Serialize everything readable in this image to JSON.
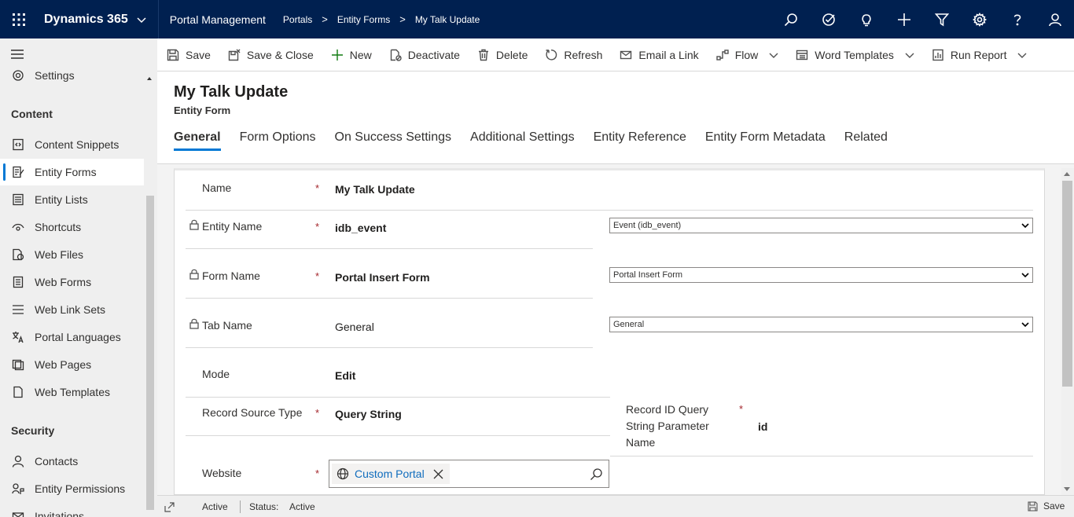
{
  "topbar": {
    "app_name": "Dynamics 365",
    "area_name": "Portal Management",
    "breadcrumbs": [
      "Portals",
      "Entity Forms",
      "My Talk Update"
    ],
    "icons": [
      "search-icon",
      "task-icon",
      "lightbulb-icon",
      "plus-icon",
      "filter-icon",
      "gear-icon",
      "help-icon",
      "user-icon"
    ]
  },
  "sidebar": {
    "top_item": "Settings",
    "sections": [
      {
        "title": "Content",
        "items": [
          "Content Snippets",
          "Entity Forms",
          "Entity Lists",
          "Shortcuts",
          "Web Files",
          "Web Forms",
          "Web Link Sets",
          "Portal Languages",
          "Web Pages",
          "Web Templates"
        ]
      },
      {
        "title": "Security",
        "items": [
          "Contacts",
          "Entity Permissions",
          "Invitations"
        ]
      }
    ],
    "active_item": "Entity Forms"
  },
  "commands": {
    "save": "Save",
    "save_close": "Save & Close",
    "new": "New",
    "deactivate": "Deactivate",
    "delete": "Delete",
    "refresh": "Refresh",
    "email_link": "Email a Link",
    "flow": "Flow",
    "word_templates": "Word Templates",
    "run_report": "Run Report"
  },
  "record": {
    "title": "My Talk Update",
    "entity": "Entity Form"
  },
  "tabs": [
    "General",
    "Form Options",
    "On Success Settings",
    "Additional Settings",
    "Entity Reference",
    "Entity Form Metadata",
    "Related"
  ],
  "form": {
    "name_label": "Name",
    "name_value": "My Talk Update",
    "entity_name_label": "Entity Name",
    "entity_name_value": "idb_event",
    "entity_name_select": "Event (idb_event)",
    "form_name_label": "Form Name",
    "form_name_value": "Portal Insert Form",
    "form_name_select": "Portal Insert Form",
    "tab_name_label": "Tab Name",
    "tab_name_value": "General",
    "tab_name_select": "General",
    "mode_label": "Mode",
    "mode_value": "Edit",
    "record_source_label": "Record Source Type",
    "record_source_value": "Query String",
    "record_id_label_1": "Record ID Query",
    "record_id_label_2": "String Parameter",
    "record_id_label_3": "Name",
    "record_id_value": "id",
    "website_label": "Website",
    "website_value": "Custom Portal",
    "required_mark": "*"
  },
  "statusbar": {
    "state": "Active",
    "status_label": "Status:",
    "status_value": "Active",
    "save": "Save"
  },
  "colors": {
    "topbar": "#002050",
    "accent": "#0078d4",
    "required": "#a4262c",
    "link": "#0f6cbd"
  }
}
